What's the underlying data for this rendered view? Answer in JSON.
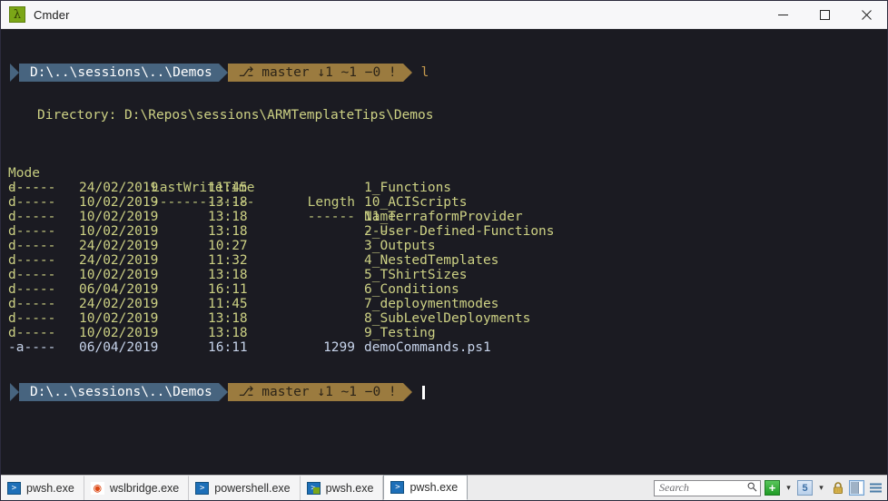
{
  "window": {
    "title": "Cmder",
    "icon": "lambda-icon",
    "icon_glyph": "λ",
    "controls": {
      "minimize": "minimize-button",
      "maximize": "maximize-button",
      "close": "close-button"
    }
  },
  "terminal": {
    "background": "#1b1b22",
    "prompt_top": {
      "path": "D:\\..\\sessions\\..\\Demos",
      "git": "⎇ master ↓1 ~1 −0 !",
      "command": "l"
    },
    "prompt_bottom": {
      "path": "D:\\..\\sessions\\..\\Demos",
      "git": "⎇ master ↓1 ~1 −0 !",
      "command": ""
    },
    "directory_line": "Directory: D:\\Repos\\sessions\\ARMTemplateTips\\Demos",
    "headers": {
      "mode": "Mode",
      "lastwritetime": "LastWriteTime",
      "length": "Length",
      "name": "Name"
    },
    "header_rules": {
      "mode": "----",
      "lastwritetime": "-------------",
      "length": "------",
      "name": "----"
    },
    "rows": [
      {
        "mode": "d-----",
        "date": "24/02/2019",
        "time": "11:45",
        "length": "",
        "name": "1_Functions",
        "kind": "dir"
      },
      {
        "mode": "d-----",
        "date": "10/02/2019",
        "time": "13:18",
        "length": "",
        "name": "10_ACIScripts",
        "kind": "dir"
      },
      {
        "mode": "d-----",
        "date": "10/02/2019",
        "time": "13:18",
        "length": "",
        "name": "11_TerraformProvider",
        "kind": "dir"
      },
      {
        "mode": "d-----",
        "date": "10/02/2019",
        "time": "13:18",
        "length": "",
        "name": "2_User-Defined-Functions",
        "kind": "dir"
      },
      {
        "mode": "d-----",
        "date": "24/02/2019",
        "time": "10:27",
        "length": "",
        "name": "3_Outputs",
        "kind": "dir"
      },
      {
        "mode": "d-----",
        "date": "24/02/2019",
        "time": "11:32",
        "length": "",
        "name": "4_NestedTemplates",
        "kind": "dir"
      },
      {
        "mode": "d-----",
        "date": "10/02/2019",
        "time": "13:18",
        "length": "",
        "name": "5_TShirtSizes",
        "kind": "dir"
      },
      {
        "mode": "d-----",
        "date": "06/04/2019",
        "time": "16:11",
        "length": "",
        "name": "6_Conditions",
        "kind": "dir"
      },
      {
        "mode": "d-----",
        "date": "24/02/2019",
        "time": "11:45",
        "length": "",
        "name": "7_deploymentmodes",
        "kind": "dir"
      },
      {
        "mode": "d-----",
        "date": "10/02/2019",
        "time": "13:18",
        "length": "",
        "name": "8_SubLevelDeployments",
        "kind": "dir"
      },
      {
        "mode": "d-----",
        "date": "10/02/2019",
        "time": "13:18",
        "length": "",
        "name": "9_Testing",
        "kind": "dir"
      },
      {
        "mode": "-a----",
        "date": "06/04/2019",
        "time": "16:11",
        "length": "1299",
        "name": "demoCommands.ps1",
        "kind": "file"
      }
    ],
    "colors": {
      "path_segment": "#47647f",
      "git_segment": "#9b7b3f",
      "command": "#c79b4e",
      "directory_text": "#cdd184",
      "file_text": "#c6d3ea"
    }
  },
  "taskbar": {
    "tabs": [
      {
        "label": "pwsh.exe",
        "icon": "powershell-icon",
        "active": false
      },
      {
        "label": "wslbridge.exe",
        "icon": "ubuntu-icon",
        "active": false
      },
      {
        "label": "powershell.exe",
        "icon": "powershell-icon",
        "active": false
      },
      {
        "label": "pwsh.exe",
        "icon": "powershell-mixed-icon",
        "active": false
      },
      {
        "label": "pwsh.exe",
        "icon": "powershell-icon",
        "active": true
      }
    ],
    "search": {
      "placeholder": "Search",
      "value": "",
      "icon": "search-icon"
    },
    "buttons": {
      "new_console": "+",
      "new_console_name": "new-console-button",
      "new_console_caret": "▾",
      "tab_count": "5",
      "tab_count_name": "tab-list-button",
      "tab_count_caret": "▾",
      "lock": "lock-icon",
      "split_pane": "split-pane-icon",
      "menu": "hamburger-menu-icon"
    }
  }
}
